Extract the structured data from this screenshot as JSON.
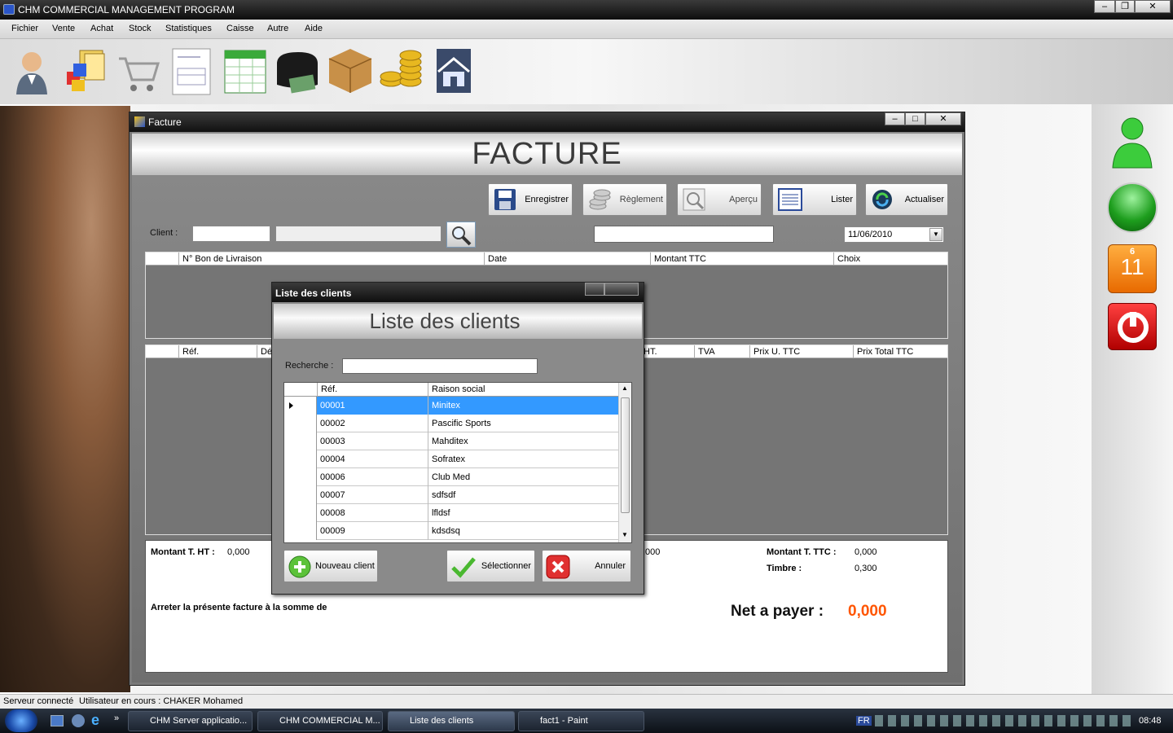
{
  "app": {
    "title": "CHM COMMERCIAL MANAGEMENT PROGRAM",
    "window_controls": [
      "–",
      "❐",
      "✕"
    ]
  },
  "menu": [
    "Fichier",
    "Vente",
    "Achat",
    "Stock",
    "Statistiques",
    "Caisse",
    "Autre",
    "Aide"
  ],
  "toolbar_icons": [
    "user-icon",
    "products-icon",
    "cart-icon",
    "document-icon",
    "spreadsheet-icon",
    "wallet-icon",
    "box-icon",
    "coins-icon",
    "home-icon"
  ],
  "facture_window": {
    "title": "Facture",
    "heading": "FACTURE",
    "buttons": {
      "enregistrer": "Enregistrer",
      "reglement": "Règlement",
      "apercu": "Aperçu",
      "lister": "Lister",
      "actualiser": "Actualiser"
    },
    "client_label": "Client :",
    "date_value": "11/06/2010",
    "livraison_columns": [
      "N° Bon de Livraison",
      "Date",
      "Montant TTC",
      "Choix"
    ],
    "article_columns": [
      "Réf.",
      "Dé",
      "HT.",
      "TVA",
      "Prix U. TTC",
      "Prix Total TTC"
    ],
    "totals": {
      "montant_ht_label": "Montant T. HT :",
      "montant_ht_value": "0,000",
      "mid_value": ",000",
      "montant_ttc_label": "Montant T. TTC :",
      "montant_ttc_value": "0,000",
      "timbre_label": "Timbre :",
      "timbre_value": "0,300",
      "arreter_text": "Arreter la présente facture à la somme de",
      "net_label": "Net a payer :",
      "net_value": "0,000"
    }
  },
  "client_dialog": {
    "title": "Liste des clients",
    "heading": "Liste des clients",
    "search_label": "Recherche :",
    "search_value": "",
    "columns": [
      "Réf.",
      "Raison social"
    ],
    "rows": [
      {
        "ref": "00001",
        "name": "Minitex"
      },
      {
        "ref": "00002",
        "name": "Pascific Sports"
      },
      {
        "ref": "00003",
        "name": "Mahditex"
      },
      {
        "ref": "00004",
        "name": "Sofratex"
      },
      {
        "ref": "00006",
        "name": "Club Med"
      },
      {
        "ref": "00007",
        "name": "sdfsdf"
      },
      {
        "ref": "00008",
        "name": "lfldsf"
      },
      {
        "ref": "00009",
        "name": "kdsdsq"
      }
    ],
    "selected_index": 0,
    "buttons": {
      "nouveau": "Nouveau client",
      "selectionner": "Sélectionner",
      "annuler": "Annuler"
    }
  },
  "side_widgets": {
    "calendar_month": "6",
    "calendar_day": "11"
  },
  "status": {
    "connection": "Serveur connecté",
    "user": "Utilisateur en cours : CHAKER Mohamed"
  },
  "taskbar": {
    "tasks": [
      "CHM Server applicatio...",
      "CHM COMMERCIAL M...",
      "Liste des clients",
      "fact1 - Paint"
    ],
    "lang": "FR",
    "clock": "08:48"
  },
  "colors": {
    "selected_row": "#3399ff",
    "net_value": "#ff5500",
    "title_bar": "#1a1a1a"
  }
}
